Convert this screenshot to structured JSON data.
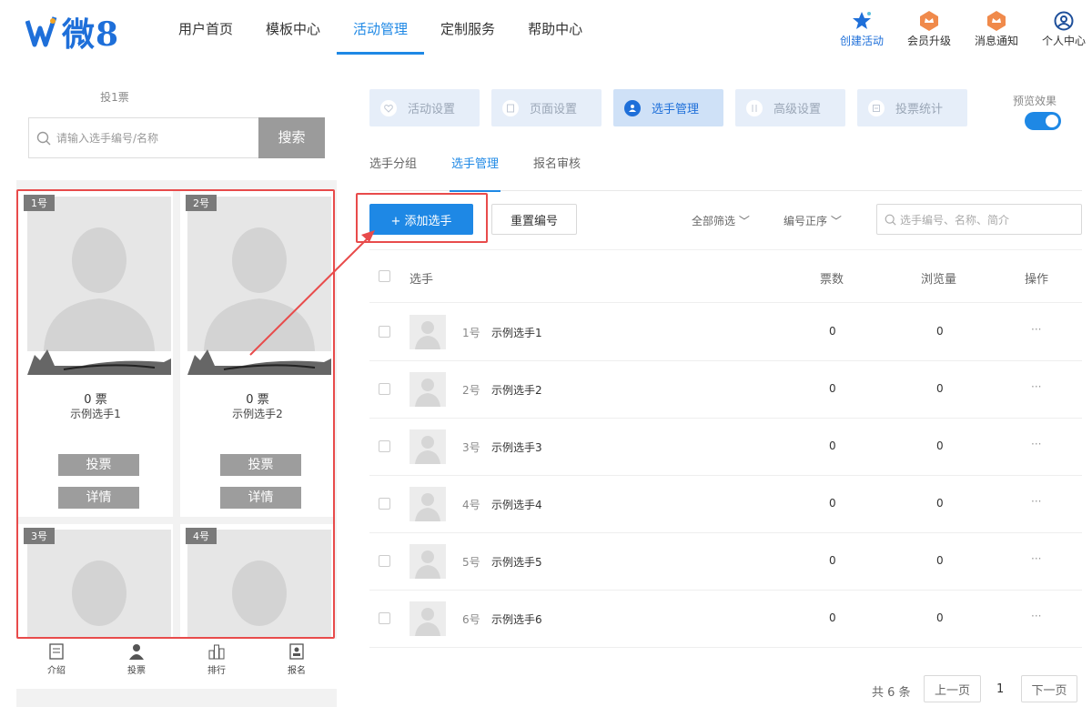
{
  "header": {
    "logo_text": "微8",
    "nav": [
      "用户首页",
      "模板中心",
      "活动管理",
      "定制服务",
      "帮助中心"
    ],
    "nav_active_index": 2,
    "tools": [
      "创建活动",
      "会员升级",
      "消息通知",
      "个人中心"
    ]
  },
  "preview": {
    "vote_count": "投1票",
    "search_placeholder": "请输入选手编号/名称",
    "search_button": "搜索",
    "cards": [
      {
        "num": "1号",
        "votes": "0 票",
        "name": "示例选手1",
        "vote_btn": "投票",
        "detail_btn": "详情"
      },
      {
        "num": "2号",
        "votes": "0 票",
        "name": "示例选手2",
        "vote_btn": "投票",
        "detail_btn": "详情"
      },
      {
        "num": "3号"
      },
      {
        "num": "4号"
      }
    ],
    "tabbar": [
      "介绍",
      "投票",
      "排行",
      "报名"
    ]
  },
  "steps": [
    {
      "label": "活动设置",
      "icon": "heart-icon"
    },
    {
      "label": "页面设置",
      "icon": "page-icon"
    },
    {
      "label": "选手管理",
      "icon": "user-icon",
      "active": true
    },
    {
      "label": "高级设置",
      "icon": "advanced-icon"
    },
    {
      "label": "投票统计",
      "icon": "stats-icon"
    }
  ],
  "preview_toggle": {
    "label": "预览效果",
    "on": true
  },
  "subtabs": [
    "选手分组",
    "选手管理",
    "报名审核"
  ],
  "subtab_active_index": 1,
  "toolbar": {
    "add_label": "+ 添加选手",
    "reset_label": "重置编号",
    "filter_all": "全部筛选",
    "sort_label": "编号正序",
    "search_placeholder": "选手编号、名称、简介"
  },
  "table": {
    "columns": [
      "选手",
      "票数",
      "浏览量",
      "操作"
    ],
    "rows": [
      {
        "num": "1号",
        "name": "示例选手1",
        "votes": "0",
        "views": "0",
        "op": "···"
      },
      {
        "num": "2号",
        "name": "示例选手2",
        "votes": "0",
        "views": "0",
        "op": "···"
      },
      {
        "num": "3号",
        "name": "示例选手3",
        "votes": "0",
        "views": "0",
        "op": "···"
      },
      {
        "num": "4号",
        "name": "示例选手4",
        "votes": "0",
        "views": "0",
        "op": "···"
      },
      {
        "num": "5号",
        "name": "示例选手5",
        "votes": "0",
        "views": "0",
        "op": "···"
      },
      {
        "num": "6号",
        "name": "示例选手6",
        "votes": "0",
        "views": "0",
        "op": "···"
      }
    ]
  },
  "pagination": {
    "total": "共 6 条",
    "prev": "上一页",
    "page": "1",
    "next": "下一页"
  },
  "colors": {
    "accent": "#1e88e5",
    "highlight": "#e84b4b"
  }
}
